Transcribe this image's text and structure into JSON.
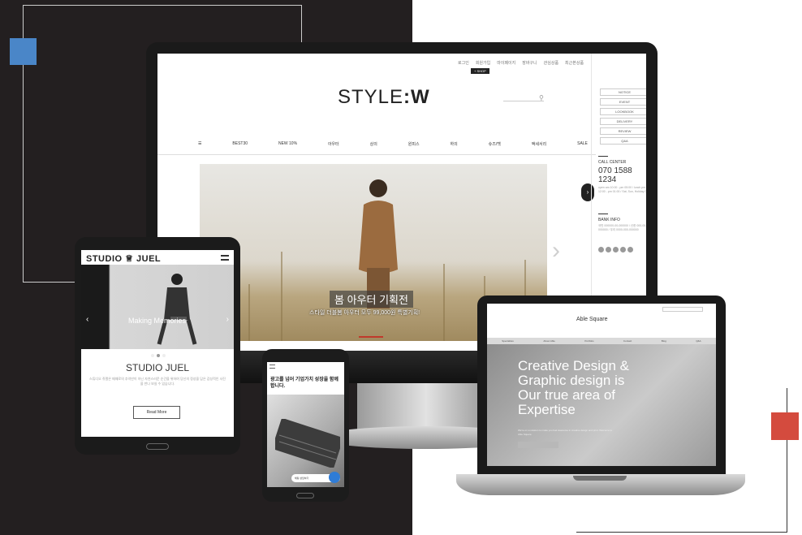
{
  "colors": {
    "dark_bg": "#231f20",
    "blue_accent": "#4a86c8",
    "red_accent": "#d44b3e",
    "hero_dot": "#c0392b"
  },
  "desktop": {
    "top_links": [
      "로그인",
      "회원가입",
      "마이페이지",
      "장바구니",
      "관심상품",
      "최근본상품"
    ],
    "shop_badge": "+ SHOP",
    "logo_light": "STYLE",
    "logo_bold": ":W",
    "search_icon": "search-icon",
    "menu": [
      "BEST30",
      "NEW 10%",
      "아우터",
      "상의",
      "원피스",
      "하의",
      "슈즈/백",
      "액세서리",
      "SALE"
    ],
    "hero_title": "봄 아우터 기획전",
    "hero_sub": "스타일 더블봄 아우터 모두 99,000원 특별기획!",
    "sidebar_buttons": [
      "NOTICE",
      "EVENT",
      "LOOKBOOK",
      "DELIVERY",
      "REVIEW",
      "Q&A"
    ],
    "call_center_title": "CALL CENTER",
    "call_center_number": "070 1588 1234",
    "call_center_hours": "open am 10:00 - pm 05:00 / lunch pm 12:00 - pm 01:00 / Sat, Sun, Holiday OFF",
    "bank_title": "BANK INFO",
    "bank_lines": "국민 000000-00-000000 / 신한 000-00-000000 / 우리 0000-000-000000"
  },
  "tablet": {
    "logo": "STUDIO ♕ JUEL",
    "hero_text": "Making Memories",
    "title": "STUDIO JUEL",
    "desc": "스튜디오 쥬엘은 때때로의 추억만이 아닌 자연스러운 순간을 위하여 당신의 정성을 담은 감성적인 사진을 만나 보실 수 있습니다.",
    "button": "Read More"
  },
  "phone": {
    "headline": "광고를 넘어 기업가치 성장을 함께 합니다.",
    "chat_label": "채팅 상담하기"
  },
  "laptop": {
    "logo": "Able Square",
    "hero_title": "Creative Design & Graphic design is Our true area of Expertise",
    "hero_sub": "We're on a mission to make you feel awesome in creative design and print. Welcome to Able Square.",
    "menu": [
      "Specialties",
      "About Able",
      "Portfolio",
      "Contact",
      "Blog",
      "Q&A"
    ]
  }
}
